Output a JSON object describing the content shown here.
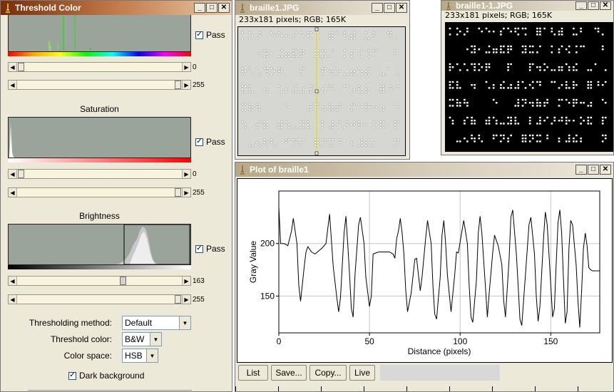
{
  "threshold_window": {
    "title": "Threshold Color",
    "hue": {
      "pass_label": "Pass",
      "min_value": "0",
      "max_value": "255"
    },
    "saturation": {
      "label": "Saturation",
      "pass_label": "Pass",
      "min_value": "0",
      "max_value": "255"
    },
    "brightness": {
      "label": "Brightness",
      "pass_label": "Pass",
      "min_value": "163",
      "max_value": "255"
    },
    "thresholding_method_label": "Thresholding method:",
    "thresholding_method_value": "Default",
    "threshold_color_label": "Threshold color:",
    "threshold_color_value": "B&W",
    "color_space_label": "Color space:",
    "color_space_value": "HSB",
    "dark_background_label": "Dark background",
    "dark_background_checked": true
  },
  "braille_window": {
    "title": "braille1.JPG",
    "info": "233x181 pixels; RGB; 165K"
  },
  "braille_thresh_window": {
    "title": "braille1-1.JPG",
    "info": "233x181 pixels; RGB; 165K"
  },
  "plot_window": {
    "title": "Plot of braille1",
    "buttons": {
      "list": "List",
      "save": "Save...",
      "copy": "Copy...",
      "live": "Live"
    }
  },
  "chart_data": {
    "type": "line",
    "title": "",
    "xlabel": "Distance (pixels)",
    "ylabel": "Gray Value",
    "xlim": [
      0,
      177
    ],
    "ylim": [
      115,
      250
    ],
    "xticks": [
      "0",
      "50",
      "100",
      "150"
    ],
    "yticks": [
      "150",
      "200"
    ],
    "grid": true,
    "series": [
      {
        "values": [
          [
            0,
            235
          ],
          [
            1,
            200
          ],
          [
            3,
            200
          ],
          [
            5,
            198
          ],
          [
            7,
            212
          ],
          [
            8,
            224
          ],
          [
            10,
            200
          ],
          [
            11,
            160
          ],
          [
            12,
            145
          ],
          [
            14,
            178
          ],
          [
            15,
            192
          ],
          [
            16,
            197
          ],
          [
            18,
            192
          ],
          [
            20,
            190
          ],
          [
            22,
            193
          ],
          [
            24,
            196
          ],
          [
            26,
            200
          ],
          [
            27,
            214
          ],
          [
            28,
            228
          ],
          [
            30,
            178
          ],
          [
            32,
            148
          ],
          [
            33,
            135
          ],
          [
            34,
            148
          ],
          [
            36,
            210
          ],
          [
            37,
            226
          ],
          [
            38,
            200
          ],
          [
            39,
            170
          ],
          [
            40,
            138
          ],
          [
            41,
            130
          ],
          [
            42,
            170
          ],
          [
            44,
            218
          ],
          [
            45,
            225
          ],
          [
            47,
            200
          ],
          [
            48,
            168
          ],
          [
            50,
            140
          ],
          [
            51,
            150
          ],
          [
            52,
            190
          ],
          [
            55,
            192
          ],
          [
            58,
            192
          ],
          [
            61,
            192
          ],
          [
            63,
            190
          ],
          [
            64,
            186
          ],
          [
            65,
            205
          ],
          [
            66,
            212
          ],
          [
            67,
            224
          ],
          [
            68,
            210
          ],
          [
            69,
            190
          ],
          [
            70,
            155
          ],
          [
            71,
            135
          ],
          [
            73,
            153
          ],
          [
            75,
            185
          ],
          [
            76,
            186
          ],
          [
            77,
            170
          ],
          [
            78,
            155
          ],
          [
            79,
            168
          ],
          [
            81,
            205
          ],
          [
            82,
            222
          ],
          [
            84,
            200
          ],
          [
            85,
            160
          ],
          [
            86,
            133
          ],
          [
            87,
            128
          ],
          [
            89,
            168
          ],
          [
            90,
            208
          ],
          [
            91,
            222
          ],
          [
            92,
            200
          ],
          [
            93,
            170
          ],
          [
            95,
            135
          ],
          [
            97,
            170
          ],
          [
            98,
            192
          ],
          [
            99,
            191
          ],
          [
            101,
            212
          ],
          [
            102,
            222
          ],
          [
            104,
            200
          ],
          [
            105,
            160
          ],
          [
            106,
            130
          ],
          [
            107,
            125
          ],
          [
            109,
            165
          ],
          [
            110,
            210
          ],
          [
            111,
            226
          ],
          [
            112,
            210
          ],
          [
            114,
            158
          ],
          [
            115,
            130
          ],
          [
            116,
            152
          ],
          [
            118,
            192
          ],
          [
            119,
            208
          ],
          [
            121,
            198
          ],
          [
            123,
            180
          ],
          [
            124,
            146
          ],
          [
            125,
            130
          ],
          [
            127,
            185
          ],
          [
            128,
            225
          ],
          [
            129,
            232
          ],
          [
            131,
            190
          ],
          [
            132,
            160
          ],
          [
            133,
            128
          ],
          [
            134,
            122
          ],
          [
            136,
            170
          ],
          [
            138,
            218
          ],
          [
            139,
            225
          ],
          [
            141,
            190
          ],
          [
            142,
            150
          ],
          [
            143,
            126
          ],
          [
            144,
            140
          ],
          [
            146,
            205
          ],
          [
            147,
            230
          ],
          [
            148,
            218
          ],
          [
            149,
            190
          ],
          [
            150,
            160
          ],
          [
            151,
            130
          ],
          [
            152,
            138
          ],
          [
            153,
            182
          ],
          [
            154,
            220
          ],
          [
            155,
            232
          ],
          [
            156,
            210
          ],
          [
            157,
            165
          ],
          [
            158,
            124
          ],
          [
            159,
            135
          ],
          [
            160,
            195
          ],
          [
            161,
            222
          ],
          [
            162,
            218
          ],
          [
            164,
            180
          ],
          [
            165,
            145
          ],
          [
            166,
            120
          ],
          [
            167,
            155
          ],
          [
            168,
            195
          ],
          [
            169,
            210
          ],
          [
            170,
            198
          ],
          [
            171,
            177
          ],
          [
            172,
            175
          ],
          [
            173,
            174
          ],
          [
            175,
            174
          ],
          [
            177,
            174
          ]
        ]
      }
    ]
  }
}
